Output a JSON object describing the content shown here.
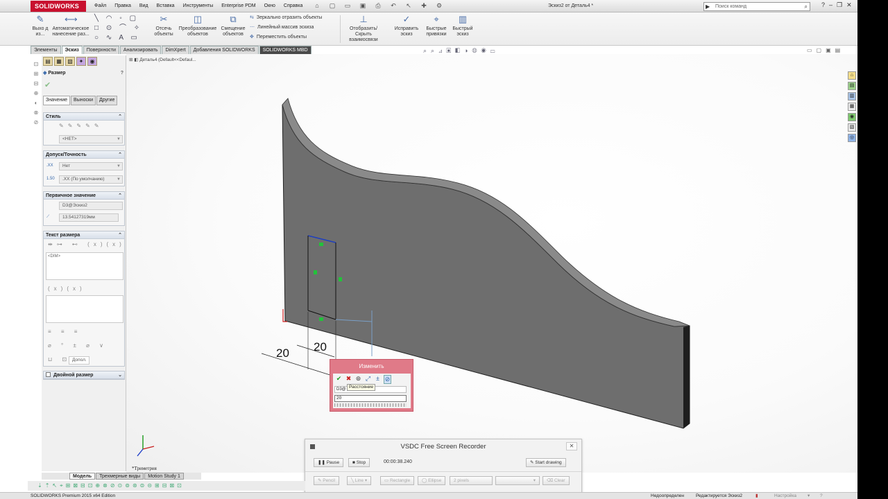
{
  "app": {
    "brand": "SOLIDWORKS",
    "document_title": "Эскиз2 от Деталь4 *",
    "menu": [
      "Файл",
      "Правка",
      "Вид",
      "Вставка",
      "Инструменты",
      "Enterprise PDM",
      "Окно",
      "Справка"
    ],
    "search_placeholder": "Поиск команд"
  },
  "ribbon": {
    "exit_sketch": "Выхо д из...",
    "smart_dimension": "Автоматическое нанесение раз...",
    "trim": "Отсечь объекты",
    "convert": "Преобразование объектов",
    "offset": "Смещение объектов",
    "mirror": "Зеркально отразить объекты",
    "linear_pattern": "Линейный массив эскиза",
    "move": "Переместить объекты",
    "relations": "Отобразить/Скрыть взаимосвязи",
    "repair": "Исправить эскиз",
    "quick_snaps": "Быстрые привязки",
    "rapid_sketch": "Быстрый эскиз"
  },
  "tabs": [
    "Элементы",
    "Эскиз",
    "Поверхности",
    "Анализировать",
    "DimXpert",
    "Добавления SOLIDWORKS",
    "SOLIDWORKS MBD"
  ],
  "active_tab": "Эскиз",
  "property_manager": {
    "title": "Размер",
    "help": "?",
    "subtabs": [
      "Значение",
      "Выноски",
      "Другие"
    ],
    "style": {
      "header": "Стиль",
      "dropdown": "<НЕТ>"
    },
    "tolerance": {
      "header": "Допуск/Точность",
      "tolerance_type": "Нет",
      "precision": ".XX (По умолчанию)"
    },
    "primary_value": {
      "header": "Первичное значение",
      "name": "D3@Эскиз2",
      "value": "13.54127319мм"
    },
    "dimension_text": {
      "header": "Текст размера",
      "content": "<DIM>",
      "more_btn": "Допол."
    },
    "dual_dimension": {
      "header": "Двойной размер"
    }
  },
  "viewport": {
    "tree_root": "Деталь4  (Default<<Defaul...",
    "dim_label_1": "20",
    "dim_label_2": "20",
    "triad_label": "*Триметрия"
  },
  "modify_dialog": {
    "title": "Изменить",
    "tooltip": "Расстояние",
    "dim_name": "D3@",
    "value": "20"
  },
  "vsdc": {
    "title": "VSDC Free Screen Recorder",
    "pause": "Pause",
    "stop": "Stop",
    "time": "00:00:38.240",
    "start_drawing": "Start drawing",
    "pencil": "Pencil",
    "line": "Line",
    "rectangle": "Rectangle",
    "ellipse": "Ellipse",
    "size": "2 pixels",
    "clear": "Clear"
  },
  "bottom_tabs": [
    "Модель",
    "Трехмерные виды",
    "Motion Study 1"
  ],
  "active_bottom_tab": "Модель",
  "status": {
    "edition": "SOLIDWORKS Premium 2015 x64 Edition",
    "state": "Недоопределен",
    "editing": "Редактируется Эскиз2",
    "settings": "Настройка"
  },
  "colors": {
    "brand_red": "#c8102e",
    "modify_dialog": "#e07a88",
    "part_face": "#6e6e6e",
    "sketch_blue": "#1f3fbf",
    "sketch_green": "#22c23a"
  }
}
